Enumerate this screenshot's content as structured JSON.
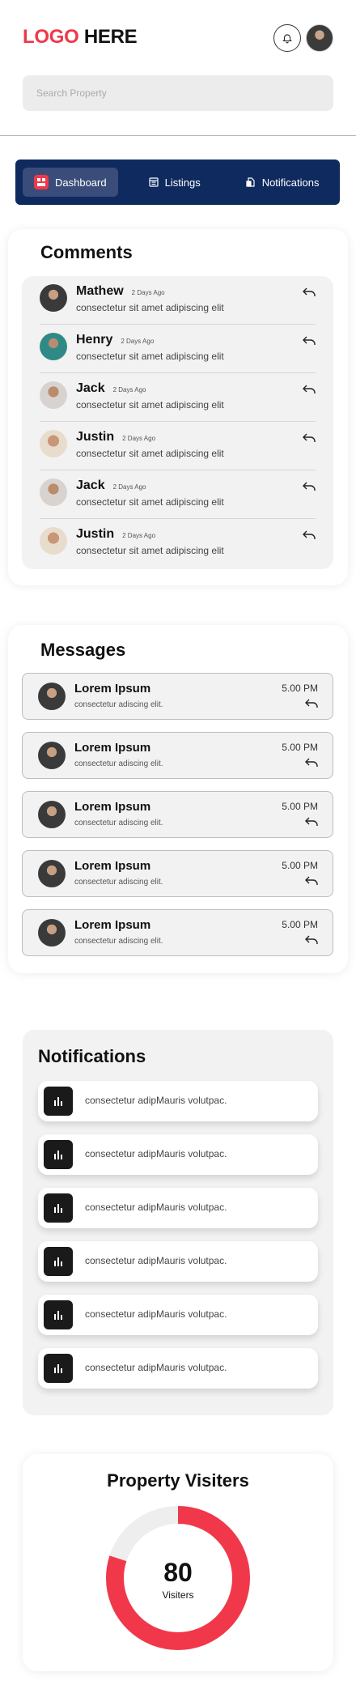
{
  "header": {
    "logo_part1": "LOGO",
    "logo_part2": "HERE"
  },
  "search": {
    "placeholder": "Search Property"
  },
  "nav": {
    "items": [
      {
        "label": "Dashboard",
        "icon": "dashboard-icon",
        "active": true
      },
      {
        "label": "Listings",
        "icon": "listings-icon",
        "active": false
      },
      {
        "label": "Notifications",
        "icon": "notifications-icon",
        "active": false
      }
    ]
  },
  "comments": {
    "title": "Comments",
    "items": [
      {
        "name": "Mathew",
        "time": "2 Days Ago",
        "text": "consectetur sit amet adipiscing elit"
      },
      {
        "name": "Henry",
        "time": "2 Days Ago",
        "text": "consectetur sit amet adipiscing elit"
      },
      {
        "name": "Jack",
        "time": "2 Days Ago",
        "text": "consectetur sit amet adipiscing elit"
      },
      {
        "name": "Justin",
        "time": "2 Days Ago",
        "text": "consectetur sit amet adipiscing elit"
      },
      {
        "name": "Jack",
        "time": "2 Days Ago",
        "text": "consectetur sit amet adipiscing elit"
      },
      {
        "name": "Justin",
        "time": "2 Days Ago",
        "text": "consectetur sit amet adipiscing elit"
      }
    ]
  },
  "messages": {
    "title": "Messages",
    "items": [
      {
        "name": "Lorem Ipsum",
        "text": "consectetur adiscing elit.",
        "time": "5.00 PM"
      },
      {
        "name": "Lorem Ipsum",
        "text": "consectetur adiscing elit.",
        "time": "5.00 PM"
      },
      {
        "name": "Lorem Ipsum",
        "text": "consectetur adiscing elit.",
        "time": "5.00 PM"
      },
      {
        "name": "Lorem Ipsum",
        "text": "consectetur adiscing elit.",
        "time": "5.00 PM"
      },
      {
        "name": "Lorem Ipsum",
        "text": "consectetur adiscing elit.",
        "time": "5.00 PM"
      }
    ]
  },
  "notifications": {
    "title": "Notifications",
    "items": [
      {
        "text": "consectetur adipMauris volutpac."
      },
      {
        "text": "consectetur adipMauris volutpac."
      },
      {
        "text": "consectetur adipMauris volutpac."
      },
      {
        "text": "consectetur adipMauris volutpac."
      },
      {
        "text": "consectetur adipMauris volutpac."
      },
      {
        "text": "consectetur adipMauris volutpac."
      }
    ]
  },
  "visitors": {
    "title": "Property Visiters",
    "value": "80",
    "label": "Visiters",
    "percent": 80
  },
  "colors": {
    "brand_red": "#f0384a",
    "nav_bg": "#0e2a5f",
    "nav_active": "#3a4d7a"
  }
}
